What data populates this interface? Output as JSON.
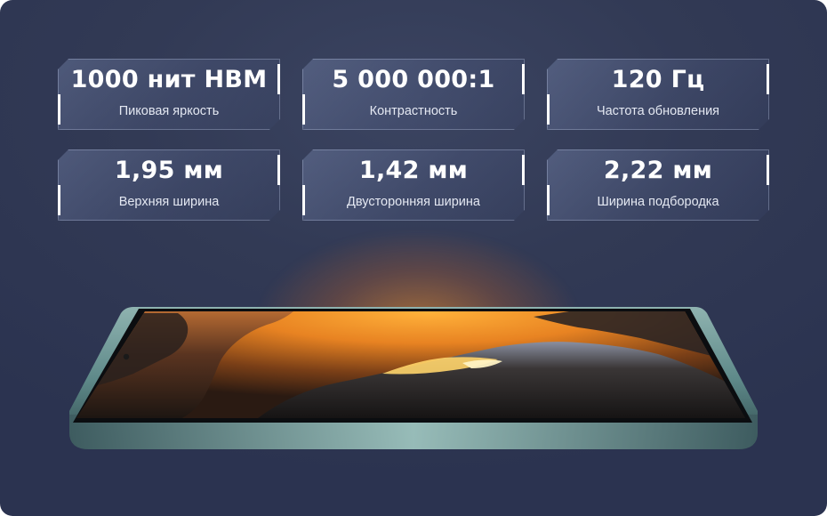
{
  "specs": [
    {
      "value": "1000 нит HBM",
      "label": "Пиковая яркость"
    },
    {
      "value": "5 000 000:1",
      "label": "Контрастность"
    },
    {
      "value": "120 Гц",
      "label": "Частота обновления"
    },
    {
      "value": "1,95 мм",
      "label": "Верхняя ширина"
    },
    {
      "value": "1,42 мм",
      "label": "Двусторонняя ширина"
    },
    {
      "value": "2,22 мм",
      "label": "Ширина подбородка"
    }
  ],
  "colors": {
    "background": "#323a55",
    "card_edge": "#ffffff",
    "screen_glow": "#ff9a2a",
    "frame": "#5f8a8a"
  },
  "illustration": "phone-display-icon"
}
